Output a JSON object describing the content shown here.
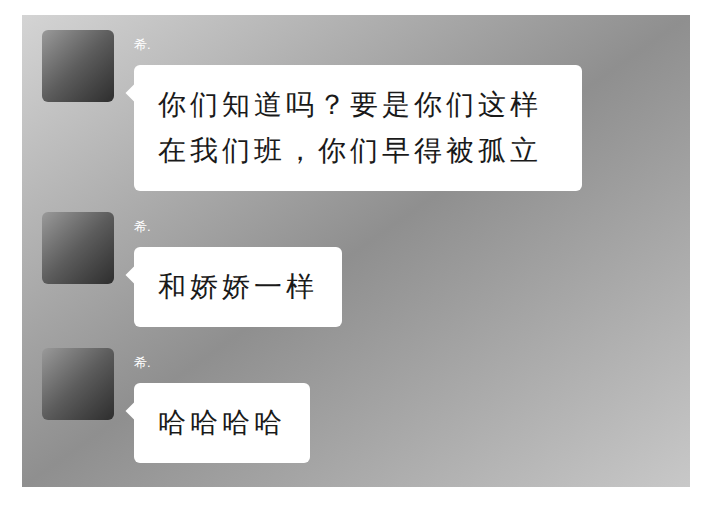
{
  "messages": [
    {
      "sender": "希.",
      "text": "你们知道吗？要是你们这样在我们班，你们早得被孤立"
    },
    {
      "sender": "希.",
      "text": "和娇娇一样"
    },
    {
      "sender": "希.",
      "text": "哈哈哈哈"
    }
  ]
}
